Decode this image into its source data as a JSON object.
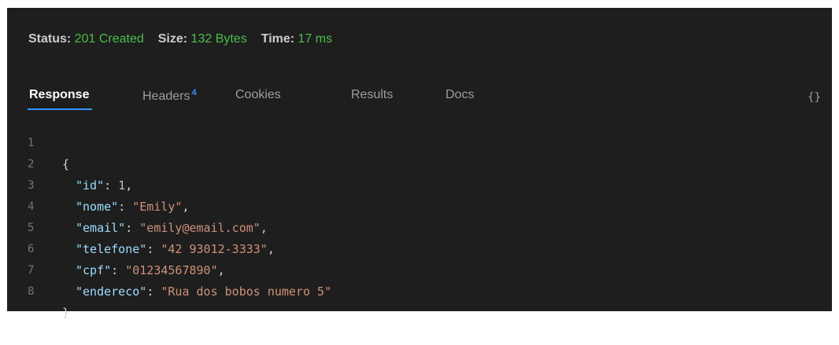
{
  "status": {
    "status_label": "Status:",
    "status_value": "201 Created",
    "size_label": "Size:",
    "size_value": "132 Bytes",
    "time_label": "Time:",
    "time_value": "17 ms"
  },
  "tabs": [
    {
      "label": "Response",
      "active": true
    },
    {
      "label": "Headers",
      "badge": "4"
    },
    {
      "label": "Cookies"
    },
    {
      "label": "Results"
    },
    {
      "label": "Docs"
    }
  ],
  "braces_icon": "{}",
  "code_lines": [
    {
      "n": "1",
      "open": "{"
    },
    {
      "n": "2",
      "key": "\"id\"",
      "sep": ": ",
      "num": "1",
      "end": ","
    },
    {
      "n": "3",
      "key": "\"nome\"",
      "sep": ": ",
      "str": "\"Emily\"",
      "end": ","
    },
    {
      "n": "4",
      "key": "\"email\"",
      "sep": ": ",
      "str": "\"emily@email.com\"",
      "end": ","
    },
    {
      "n": "5",
      "key": "\"telefone\"",
      "sep": ": ",
      "str": "\"42 93012-3333\"",
      "end": ","
    },
    {
      "n": "6",
      "key": "\"cpf\"",
      "sep": ": ",
      "str": "\"01234567890\"",
      "end": ","
    },
    {
      "n": "7",
      "key": "\"endereco\"",
      "sep": ": ",
      "str": "\"Rua dos bobos numero 5\"",
      "end": ""
    },
    {
      "n": "8",
      "close": "}"
    }
  ],
  "colors": {
    "status_green": "#4bbf4b",
    "accent_blue": "#3794ff",
    "key": "#9cdcfe",
    "string": "#ce9178",
    "number": "#b5cea8"
  }
}
